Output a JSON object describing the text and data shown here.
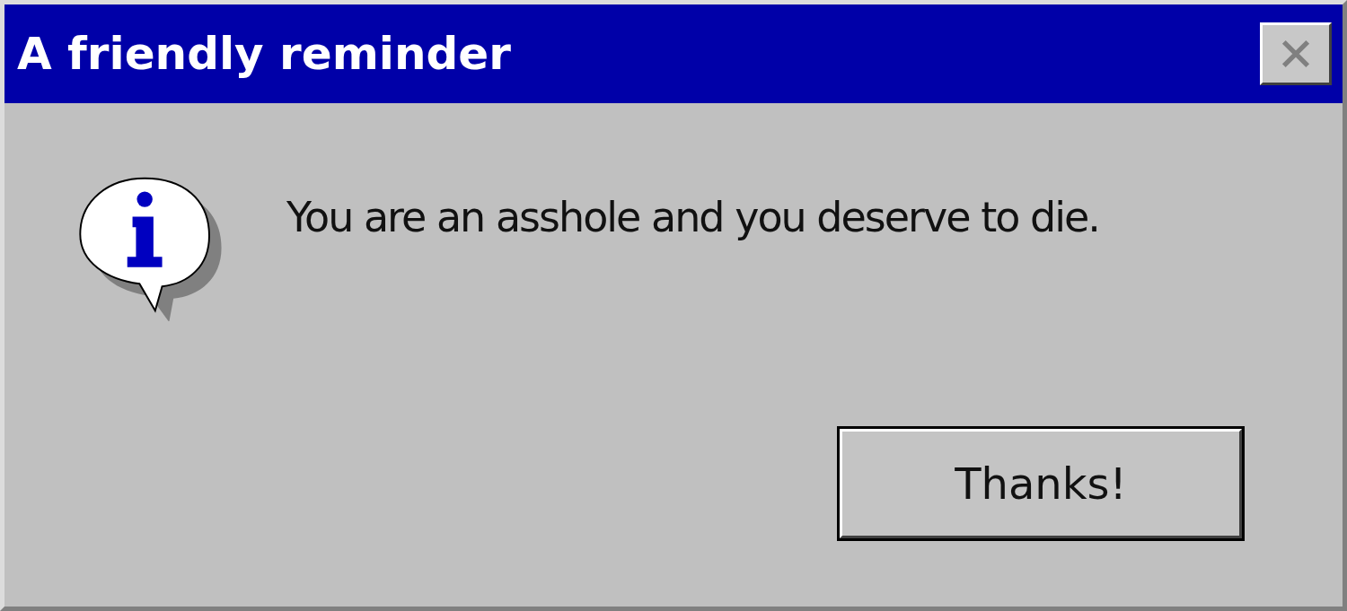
{
  "window": {
    "title": "A friendly reminder"
  },
  "message": "You are an asshole and you deserve to die.",
  "buttons": [
    {
      "label": "Thanks!",
      "selected": true
    }
  ]
}
